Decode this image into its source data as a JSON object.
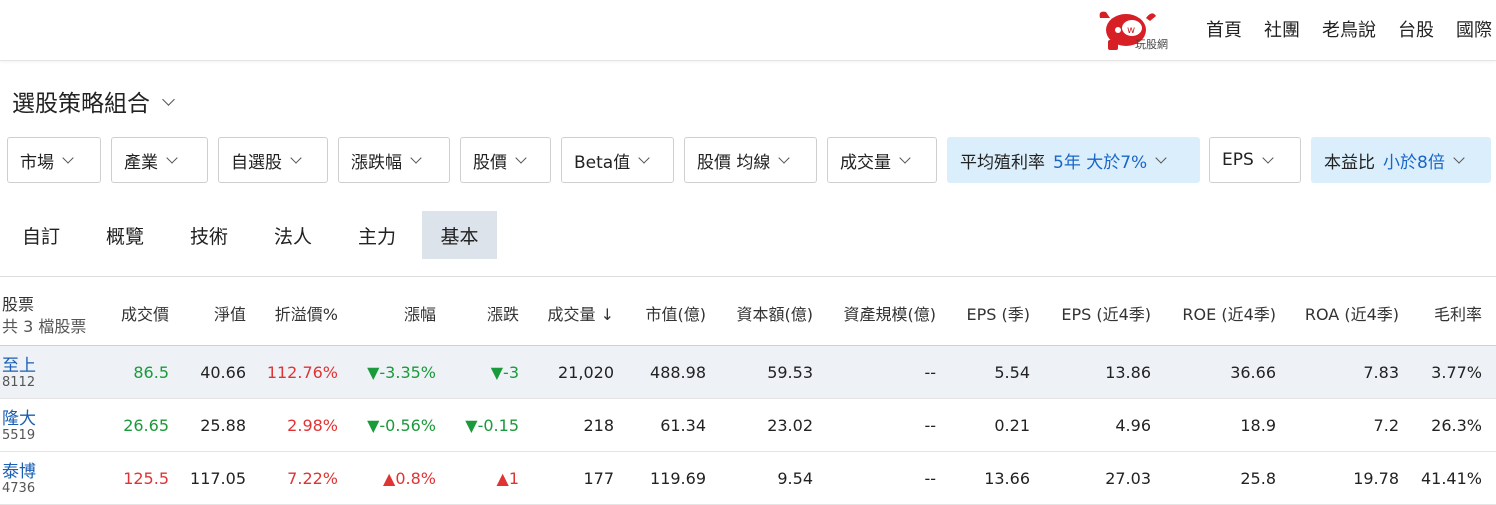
{
  "header": {
    "logo_text": "玩股網",
    "nav": [
      "首頁",
      "社團",
      "老鳥說",
      "台股",
      "國際"
    ]
  },
  "page_title": "選股策略組合",
  "filters": [
    {
      "label": "市場",
      "value": ""
    },
    {
      "label": "產業",
      "value": ""
    },
    {
      "label": "自選股",
      "value": ""
    },
    {
      "label": "漲跌幅",
      "value": ""
    },
    {
      "label": "股價",
      "value": ""
    },
    {
      "label": "Beta值",
      "value": ""
    },
    {
      "label": "股價 均線",
      "value": ""
    },
    {
      "label": "成交量",
      "value": ""
    },
    {
      "label": "平均殖利率",
      "value": "5年 大於7%"
    },
    {
      "label": "EPS",
      "value": ""
    },
    {
      "label": "本益比",
      "value": "小於8倍"
    }
  ],
  "tabs": [
    "自訂",
    "概覽",
    "技術",
    "法人",
    "主力",
    "基本"
  ],
  "active_tab": "基本",
  "table": {
    "stock_header": "股票",
    "count_text": "共 3 檔股票",
    "columns": [
      "成交價",
      "淨值",
      "折溢價%",
      "漲幅",
      "漲跌",
      "成交量 ↓",
      "市值(億)",
      "資本額(億)",
      "資產規模(億)",
      "EPS (季)",
      "EPS (近4季)",
      "ROE (近4季)",
      "ROA (近4季)",
      "毛利率"
    ],
    "rows": [
      {
        "name": "至上",
        "code": "8112",
        "price": "86.5",
        "nav": "40.66",
        "premium": "112.76%",
        "change_pct": "▼-3.35%",
        "change": "▼-3",
        "volume": "21,020",
        "mcap": "488.98",
        "capital": "59.53",
        "assets": "--",
        "eps_q": "5.54",
        "eps_4q": "13.86",
        "roe": "36.66",
        "roa": "7.83",
        "gm": "3.77%"
      },
      {
        "name": "隆大",
        "code": "5519",
        "price": "26.65",
        "nav": "25.88",
        "premium": "2.98%",
        "change_pct": "▼-0.56%",
        "change": "▼-0.15",
        "volume": "218",
        "mcap": "61.34",
        "capital": "23.02",
        "assets": "--",
        "eps_q": "0.21",
        "eps_4q": "4.96",
        "roe": "18.9",
        "roa": "7.2",
        "gm": "26.3%"
      },
      {
        "name": "泰博",
        "code": "4736",
        "price": "125.5",
        "nav": "117.05",
        "premium": "7.22%",
        "change_pct": "▲0.8%",
        "change": "▲1",
        "volume": "177",
        "mcap": "119.69",
        "capital": "9.54",
        "assets": "--",
        "eps_q": "13.66",
        "eps_4q": "27.03",
        "roe": "25.8",
        "roa": "19.78",
        "gm": "41.41%"
      }
    ]
  },
  "colors": {
    "up": "#e03434",
    "down": "#1a9a3a",
    "link": "#1a5fb4",
    "active_filter": "#dbeefb"
  }
}
